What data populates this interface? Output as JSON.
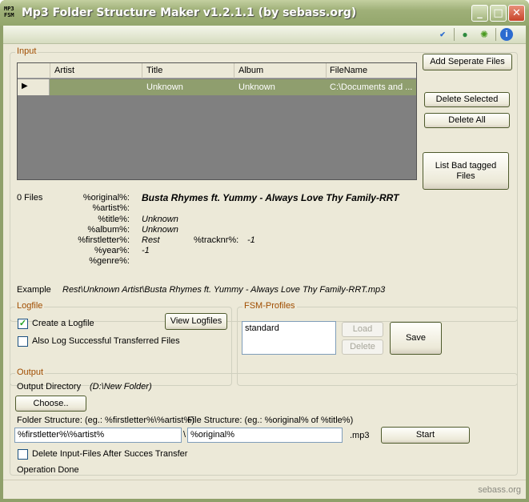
{
  "window": {
    "title": "Mp3 Folder Structure Maker v1.2.1.1 (by sebass.org)",
    "icon_text": "MP3 FSM"
  },
  "toolbar": {
    "icons": [
      "spellcheck-icon",
      "globe-icon",
      "bug-icon",
      "info-icon"
    ]
  },
  "input": {
    "label": "Input",
    "columns": [
      "Artist",
      "Title",
      "Album",
      "FileName"
    ],
    "rows": [
      {
        "artist": "",
        "title": "Unknown",
        "album": "Unknown",
        "filename": "C:\\Documents and ..."
      }
    ],
    "file_count": "0 Files",
    "tags": {
      "original_label": "%original%:",
      "original": "Busta Rhymes ft. Yummy - Always Love Thy Family-RRT",
      "artist_label": "%artist%:",
      "artist": "",
      "title_label": "%title%:",
      "title": "Unknown",
      "album_label": "%album%:",
      "album": "Unknown",
      "firstletter_label": "%firstletter%:",
      "firstletter": "Rest",
      "tracknr_label": "%tracknr%:",
      "tracknr": "-1",
      "year_label": "%year%:",
      "year": "-1",
      "genre_label": "%genre%:",
      "genre": ""
    },
    "example_label": "Example",
    "example": "Rest\\Unknown Artist\\Busta Rhymes ft. Yummy - Always Love Thy Family-RRT.mp3"
  },
  "side_buttons": {
    "add_separate": "Add Seperate Files",
    "delete_selected": "Delete Selected",
    "delete_all": "Delete All",
    "list_bad": "List Bad tagged Files"
  },
  "logfile": {
    "label": "Logfile",
    "create": "Create a Logfile",
    "create_checked": true,
    "also_log": "Also Log Successful Transferred Files",
    "also_log_checked": false,
    "view": "View Logfiles"
  },
  "profiles": {
    "label": "FSM-Profiles",
    "items": [
      "standard"
    ],
    "load": "Load",
    "delete": "Delete",
    "save": "Save"
  },
  "output": {
    "label": "Output",
    "dir_label": "Output Directory",
    "dir": "(D:\\New Folder)",
    "choose": "Choose..",
    "folder_label": "Folder Structure: (eg.: %firstletter%\\%artist%)",
    "file_label": "File Structure: (eg.: %original% of %title%)",
    "folder_value": "%firstletter%\\%artist%",
    "sep": "\\",
    "file_value": "%original%",
    "ext": ".mp3",
    "start": "Start",
    "delete_input": "Delete Input-Files After Succes Transfer",
    "delete_input_checked": false,
    "status": "Operation Done"
  },
  "statusbar": {
    "text": "sebass.org"
  }
}
